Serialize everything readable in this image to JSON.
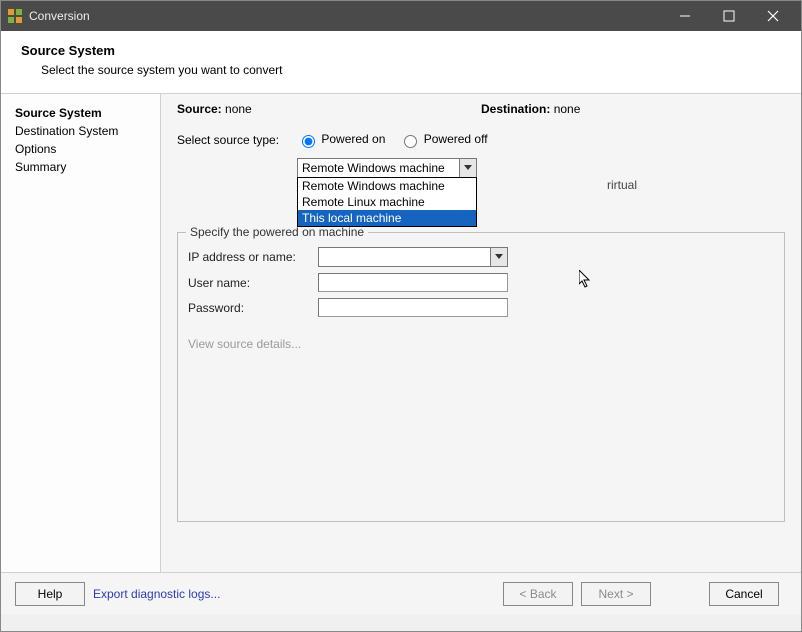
{
  "window": {
    "title": "Conversion"
  },
  "header": {
    "title": "Source System",
    "subtitle": "Select the source system you want to convert"
  },
  "sidebar": {
    "steps": [
      {
        "label": "Source System",
        "active": true
      },
      {
        "label": "Destination System"
      },
      {
        "label": "Options"
      },
      {
        "label": "Summary"
      }
    ]
  },
  "content": {
    "source_label": "Source:",
    "source_value": "none",
    "dest_label": "Destination:",
    "dest_value": "none",
    "select_type_label": "Select source type:",
    "radio_on": "Powered on",
    "radio_off": "Powered off",
    "dropdown_selected": "Remote Windows machine",
    "dropdown_options": [
      "Remote Windows machine",
      "Remote Linux machine",
      "This local machine"
    ],
    "hint_fragment": "rirtual",
    "fieldset_legend": "Specify the powered on machine",
    "ip_label": "IP address or name:",
    "user_label": "User name:",
    "pass_label": "Password:",
    "view_details": "View source details..."
  },
  "footer": {
    "help": "Help",
    "export": "Export diagnostic logs...",
    "back": "< Back",
    "next": "Next >",
    "cancel": "Cancel"
  }
}
